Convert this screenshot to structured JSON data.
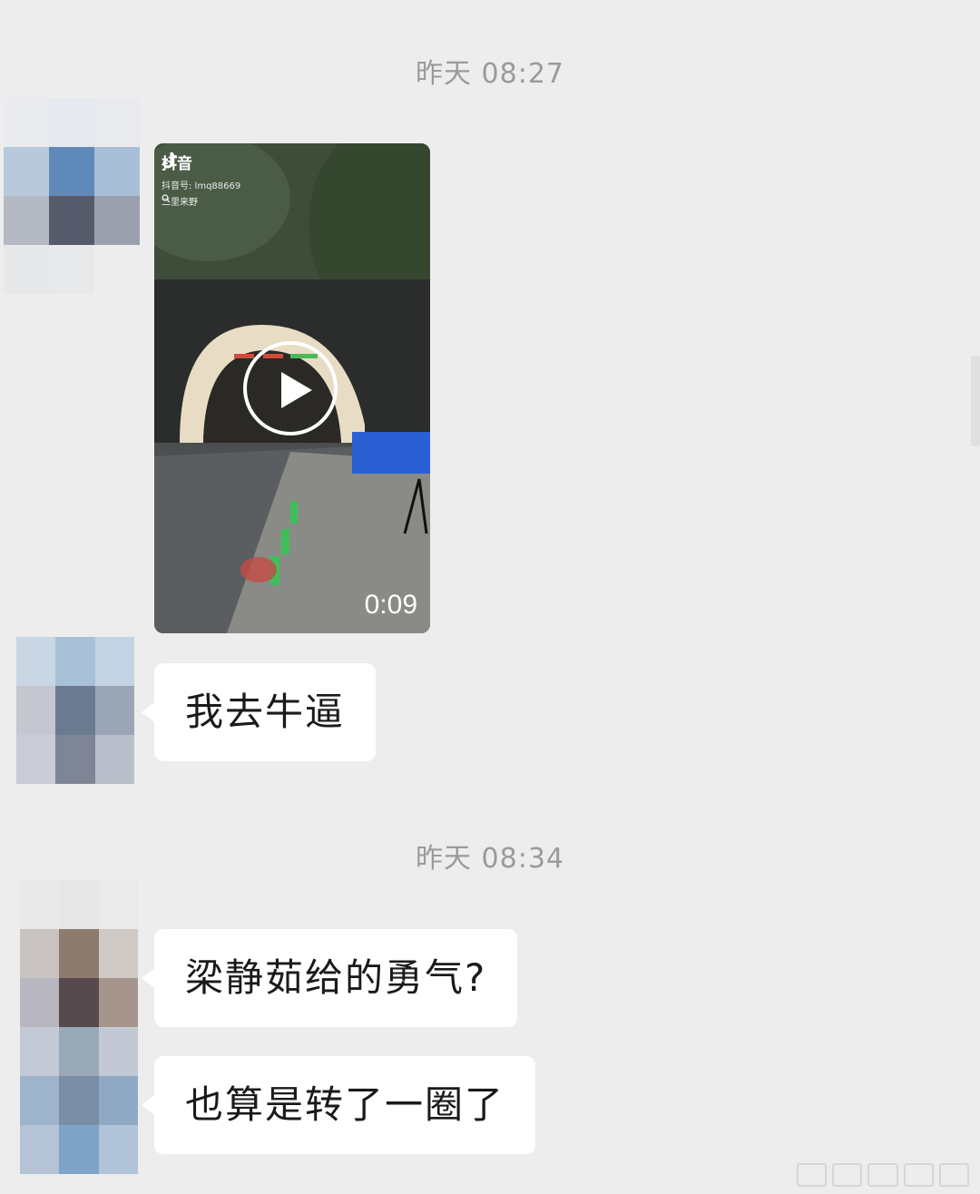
{
  "messages": {
    "timestamp_1": "昨天 08:27",
    "timestamp_2": "昨天 08:34",
    "video": {
      "app_name": "抖音",
      "account_line": "抖音号: lmq88669",
      "search_line": "二里来野",
      "duration": "0:09"
    },
    "bubble_1": "我去牛逼",
    "bubble_2": "梁静茹给的勇气?",
    "bubble_3": "也算是转了一圈了"
  },
  "colors": {
    "background": "#ededed",
    "bubble": "#ffffff",
    "timestamp_text": "#9a9a9a"
  },
  "icons": {
    "play": "play-icon",
    "tiktok": "tiktok-icon",
    "search": "search-icon"
  }
}
